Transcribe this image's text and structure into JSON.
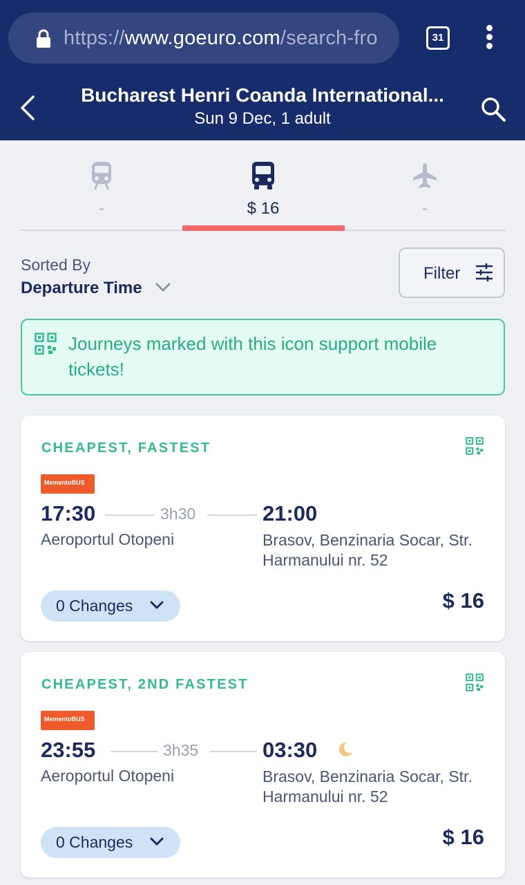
{
  "browser": {
    "url_scheme": "https://",
    "url_host": "www.goeuro.com",
    "url_path": "/search-fro",
    "tab_count": "31"
  },
  "header": {
    "title": "Bucharest Henri Coanda International...",
    "subtitle": "Sun 9 Dec, 1 adult"
  },
  "modes": [
    {
      "icon": "train-icon",
      "price": "-"
    },
    {
      "icon": "bus-icon",
      "price": "$ 16"
    },
    {
      "icon": "plane-icon",
      "price": "-"
    }
  ],
  "sort": {
    "label": "Sorted By",
    "value": "Departure Time"
  },
  "filter": {
    "label": "Filter"
  },
  "info_banner": {
    "text": "Journeys marked with this icon support mobile tickets!"
  },
  "journeys": [
    {
      "tag": "CHEAPEST, FASTEST",
      "operator": "MementoBUS",
      "departure_time": "17:30",
      "duration": "3h30",
      "arrival_time": "21:00",
      "departure_station": "Aeroportul Otopeni",
      "arrival_station": "Brasov, Benzinaria Socar, Str. Harmanului nr. 52",
      "changes": "0 Changes",
      "price": "$ 16"
    },
    {
      "tag": "CHEAPEST, 2ND FASTEST",
      "operator": "MementoBUS",
      "departure_time": "23:55",
      "duration": "3h35",
      "arrival_time": "03:30",
      "departure_station": "Aeroportul Otopeni",
      "arrival_station": "Brasov, Benzinaria Socar, Str. Harmanului nr. 52",
      "changes": "0 Changes",
      "price": "$ 16"
    }
  ],
  "colors": {
    "brand_navy": "#172c6b",
    "accent_green": "#34b993",
    "active_tab": "#f26a6a"
  }
}
